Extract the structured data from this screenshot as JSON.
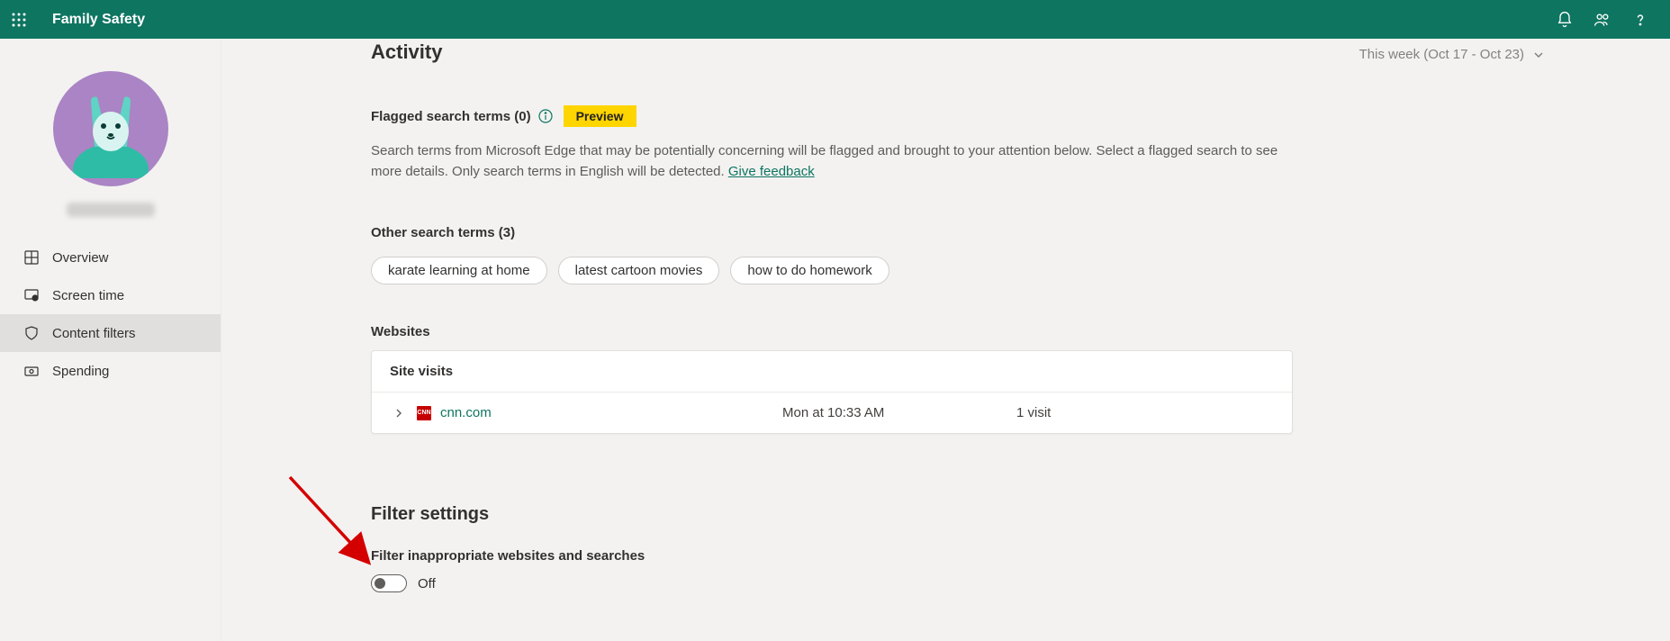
{
  "header": {
    "title": "Family Safety"
  },
  "sidebar": {
    "items": [
      {
        "label": "Overview"
      },
      {
        "label": "Screen time"
      },
      {
        "label": "Content filters"
      },
      {
        "label": "Spending"
      }
    ]
  },
  "main": {
    "activity_title": "Activity",
    "date_range": "This week (Oct 17 - Oct 23)",
    "flagged_heading": "Flagged search terms (0)",
    "preview_label": "Preview",
    "flagged_description": "Search terms from Microsoft Edge that may be potentially concerning will be flagged and brought to your attention below. Select a flagged search to see more details. Only search terms in English will be detected. ",
    "feedback_link": "Give feedback",
    "other_terms_heading": "Other search terms (3)",
    "chips": [
      "karate learning at home",
      "latest cartoon movies",
      "how to do homework"
    ],
    "websites_heading": "Websites",
    "site_visits_heading": "Site visits",
    "site_visits": [
      {
        "domain": "cnn.com",
        "timestamp": "Mon at 10:33 AM",
        "visits": "1 visit",
        "favicon_text": "CNN"
      }
    ],
    "filter_settings_heading": "Filter settings",
    "filter_sub_heading": "Filter inappropriate websites and searches",
    "toggle_state": "Off"
  }
}
